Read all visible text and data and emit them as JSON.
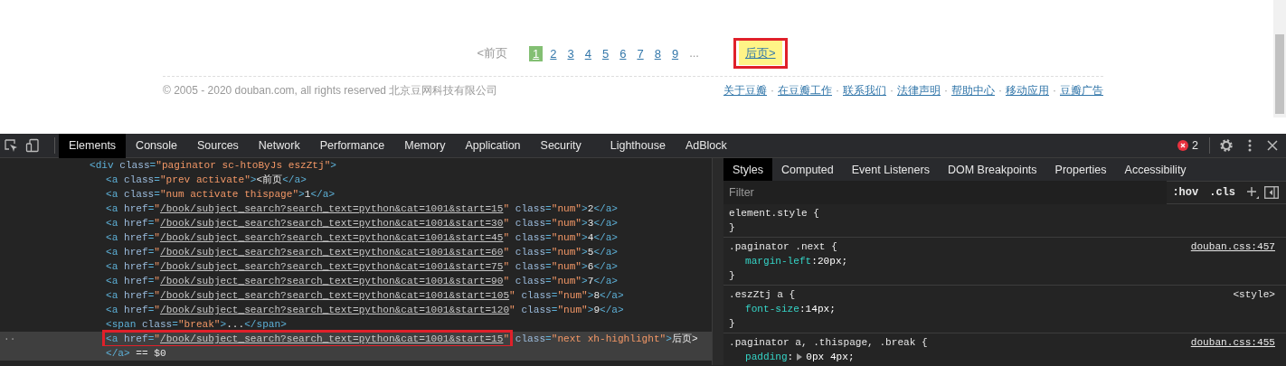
{
  "page": {
    "pagination": {
      "prev": "<前页",
      "pages": [
        {
          "label": "1",
          "selected": true
        },
        {
          "label": "2",
          "selected": false
        },
        {
          "label": "3",
          "selected": false
        },
        {
          "label": "4",
          "selected": false
        },
        {
          "label": "5",
          "selected": false
        },
        {
          "label": "6",
          "selected": false
        },
        {
          "label": "7",
          "selected": false
        },
        {
          "label": "8",
          "selected": false
        },
        {
          "label": "9",
          "selected": false
        }
      ],
      "ellipsis": "...",
      "next": {
        "label": "后页>",
        "highlighted": true,
        "annotated": true
      }
    },
    "footer": {
      "copyright": "© 2005 - 2020 douban.com, all rights reserved 北京豆网科技有限公司",
      "separator": "·",
      "links": [
        "关于豆瓣",
        "在豆瓣工作",
        "联系我们",
        "法律声明",
        "帮助中心",
        "移动应用",
        "豆瓣广告"
      ]
    }
  },
  "devtools": {
    "tabs": [
      {
        "label": "Elements",
        "selected": true
      },
      {
        "label": "Console",
        "selected": false
      },
      {
        "label": "Sources",
        "selected": false
      },
      {
        "label": "Network",
        "selected": false
      },
      {
        "label": "Performance",
        "selected": false
      },
      {
        "label": "Memory",
        "selected": false
      },
      {
        "label": "Application",
        "selected": false
      },
      {
        "label": "Security",
        "selected": false
      },
      {
        "label": "Lighthouse",
        "selected": false
      },
      {
        "label": "AdBlock",
        "selected": false
      }
    ],
    "error_count": "2",
    "elements": {
      "lines": [
        {
          "selected": false,
          "annotated": false,
          "tokens": [
            {
              "kind": "tag",
              "s": "<div"
            },
            {
              "kind": "attr",
              "s": " class"
            },
            {
              "kind": "tag",
              "s": "="
            },
            {
              "kind": "val",
              "s": "\"paginator sc-htoByJs eszZtj\""
            },
            {
              "kind": "tag",
              "s": ">"
            }
          ],
          "children": [
            {
              "selected": false,
              "annotated": false,
              "tokens": [
                {
                  "kind": "tag",
                  "s": "<a"
                },
                {
                  "kind": "attr",
                  "s": " class"
                },
                {
                  "kind": "tag",
                  "s": "="
                },
                {
                  "kind": "val",
                  "s": "\"prev activate\""
                },
                {
                  "kind": "tag",
                  "s": ">"
                },
                {
                  "kind": "text",
                  "s": "<前页"
                },
                {
                  "kind": "tag",
                  "s": "</a>"
                }
              ]
            },
            {
              "selected": false,
              "annotated": false,
              "tokens": [
                {
                  "kind": "tag",
                  "s": "<a"
                },
                {
                  "kind": "attr",
                  "s": " class"
                },
                {
                  "kind": "tag",
                  "s": "="
                },
                {
                  "kind": "val",
                  "s": "\"num activate thispage\""
                },
                {
                  "kind": "tag",
                  "s": ">"
                },
                {
                  "kind": "text",
                  "s": "1"
                },
                {
                  "kind": "tag",
                  "s": "</a>"
                }
              ]
            },
            {
              "selected": false,
              "annotated": false,
              "tokens": [
                {
                  "kind": "tag",
                  "s": "<a"
                },
                {
                  "kind": "attr",
                  "s": " href"
                },
                {
                  "kind": "tag",
                  "s": "="
                },
                {
                  "kind": "val",
                  "s": "\""
                },
                {
                  "kind": "link",
                  "s": "/book/subject_search?search_text=python&cat=1001&start=15"
                },
                {
                  "kind": "val",
                  "s": "\""
                },
                {
                  "kind": "attr",
                  "s": " class"
                },
                {
                  "kind": "tag",
                  "s": "="
                },
                {
                  "kind": "val",
                  "s": "\"num\""
                },
                {
                  "kind": "tag",
                  "s": ">"
                },
                {
                  "kind": "text",
                  "s": "2"
                },
                {
                  "kind": "tag",
                  "s": "</a>"
                }
              ]
            },
            {
              "selected": false,
              "annotated": false,
              "tokens": [
                {
                  "kind": "tag",
                  "s": "<a"
                },
                {
                  "kind": "attr",
                  "s": " href"
                },
                {
                  "kind": "tag",
                  "s": "="
                },
                {
                  "kind": "val",
                  "s": "\""
                },
                {
                  "kind": "link",
                  "s": "/book/subject_search?search_text=python&cat=1001&start=30"
                },
                {
                  "kind": "val",
                  "s": "\""
                },
                {
                  "kind": "attr",
                  "s": " class"
                },
                {
                  "kind": "tag",
                  "s": "="
                },
                {
                  "kind": "val",
                  "s": "\"num\""
                },
                {
                  "kind": "tag",
                  "s": ">"
                },
                {
                  "kind": "text",
                  "s": "3"
                },
                {
                  "kind": "tag",
                  "s": "</a>"
                }
              ]
            },
            {
              "selected": false,
              "annotated": false,
              "tokens": [
                {
                  "kind": "tag",
                  "s": "<a"
                },
                {
                  "kind": "attr",
                  "s": " href"
                },
                {
                  "kind": "tag",
                  "s": "="
                },
                {
                  "kind": "val",
                  "s": "\""
                },
                {
                  "kind": "link",
                  "s": "/book/subject_search?search_text=python&cat=1001&start=45"
                },
                {
                  "kind": "val",
                  "s": "\""
                },
                {
                  "kind": "attr",
                  "s": " class"
                },
                {
                  "kind": "tag",
                  "s": "="
                },
                {
                  "kind": "val",
                  "s": "\"num\""
                },
                {
                  "kind": "tag",
                  "s": ">"
                },
                {
                  "kind": "text",
                  "s": "4"
                },
                {
                  "kind": "tag",
                  "s": "</a>"
                }
              ]
            },
            {
              "selected": false,
              "annotated": false,
              "tokens": [
                {
                  "kind": "tag",
                  "s": "<a"
                },
                {
                  "kind": "attr",
                  "s": " href"
                },
                {
                  "kind": "tag",
                  "s": "="
                },
                {
                  "kind": "val",
                  "s": "\""
                },
                {
                  "kind": "link",
                  "s": "/book/subject_search?search_text=python&cat=1001&start=60"
                },
                {
                  "kind": "val",
                  "s": "\""
                },
                {
                  "kind": "attr",
                  "s": " class"
                },
                {
                  "kind": "tag",
                  "s": "="
                },
                {
                  "kind": "val",
                  "s": "\"num\""
                },
                {
                  "kind": "tag",
                  "s": ">"
                },
                {
                  "kind": "text",
                  "s": "5"
                },
                {
                  "kind": "tag",
                  "s": "</a>"
                }
              ]
            },
            {
              "selected": false,
              "annotated": false,
              "tokens": [
                {
                  "kind": "tag",
                  "s": "<a"
                },
                {
                  "kind": "attr",
                  "s": " href"
                },
                {
                  "kind": "tag",
                  "s": "="
                },
                {
                  "kind": "val",
                  "s": "\""
                },
                {
                  "kind": "link",
                  "s": "/book/subject_search?search_text=python&cat=1001&start=75"
                },
                {
                  "kind": "val",
                  "s": "\""
                },
                {
                  "kind": "attr",
                  "s": " class"
                },
                {
                  "kind": "tag",
                  "s": "="
                },
                {
                  "kind": "val",
                  "s": "\"num\""
                },
                {
                  "kind": "tag",
                  "s": ">"
                },
                {
                  "kind": "text",
                  "s": "6"
                },
                {
                  "kind": "tag",
                  "s": "</a>"
                }
              ]
            },
            {
              "selected": false,
              "annotated": false,
              "tokens": [
                {
                  "kind": "tag",
                  "s": "<a"
                },
                {
                  "kind": "attr",
                  "s": " href"
                },
                {
                  "kind": "tag",
                  "s": "="
                },
                {
                  "kind": "val",
                  "s": "\""
                },
                {
                  "kind": "link",
                  "s": "/book/subject_search?search_text=python&cat=1001&start=90"
                },
                {
                  "kind": "val",
                  "s": "\""
                },
                {
                  "kind": "attr",
                  "s": " class"
                },
                {
                  "kind": "tag",
                  "s": "="
                },
                {
                  "kind": "val",
                  "s": "\"num\""
                },
                {
                  "kind": "tag",
                  "s": ">"
                },
                {
                  "kind": "text",
                  "s": "7"
                },
                {
                  "kind": "tag",
                  "s": "</a>"
                }
              ]
            },
            {
              "selected": false,
              "annotated": false,
              "tokens": [
                {
                  "kind": "tag",
                  "s": "<a"
                },
                {
                  "kind": "attr",
                  "s": " href"
                },
                {
                  "kind": "tag",
                  "s": "="
                },
                {
                  "kind": "val",
                  "s": "\""
                },
                {
                  "kind": "link",
                  "s": "/book/subject_search?search_text=python&cat=1001&start=105"
                },
                {
                  "kind": "val",
                  "s": "\""
                },
                {
                  "kind": "attr",
                  "s": " class"
                },
                {
                  "kind": "tag",
                  "s": "="
                },
                {
                  "kind": "val",
                  "s": "\"num\""
                },
                {
                  "kind": "tag",
                  "s": ">"
                },
                {
                  "kind": "text",
                  "s": "8"
                },
                {
                  "kind": "tag",
                  "s": "</a>"
                }
              ]
            },
            {
              "selected": false,
              "annotated": false,
              "tokens": [
                {
                  "kind": "tag",
                  "s": "<a"
                },
                {
                  "kind": "attr",
                  "s": " href"
                },
                {
                  "kind": "tag",
                  "s": "="
                },
                {
                  "kind": "val",
                  "s": "\""
                },
                {
                  "kind": "link",
                  "s": "/book/subject_search?search_text=python&cat=1001&start=120"
                },
                {
                  "kind": "val",
                  "s": "\""
                },
                {
                  "kind": "attr",
                  "s": " class"
                },
                {
                  "kind": "tag",
                  "s": "="
                },
                {
                  "kind": "val",
                  "s": "\"num\""
                },
                {
                  "kind": "tag",
                  "s": ">"
                },
                {
                  "kind": "text",
                  "s": "9"
                },
                {
                  "kind": "tag",
                  "s": "</a>"
                }
              ]
            },
            {
              "selected": false,
              "annotated": false,
              "tokens": [
                {
                  "kind": "tag",
                  "s": "<span"
                },
                {
                  "kind": "attr",
                  "s": " class"
                },
                {
                  "kind": "tag",
                  "s": "="
                },
                {
                  "kind": "val",
                  "s": "\"break\""
                },
                {
                  "kind": "tag",
                  "s": ">"
                },
                {
                  "kind": "text",
                  "s": "..."
                },
                {
                  "kind": "tag",
                  "s": "</span>"
                }
              ]
            },
            {
              "selected": true,
              "annotated": true,
              "gutter": "··",
              "tokens": [
                {
                  "kind": "tag",
                  "s": "<a"
                },
                {
                  "kind": "attr",
                  "s": " href"
                },
                {
                  "kind": "tag",
                  "s": "="
                },
                {
                  "kind": "val",
                  "s": "\""
                },
                {
                  "kind": "link",
                  "s": "/book/subject_search?search_text=python&cat=1001&start=15"
                },
                {
                  "kind": "val",
                  "s": "\""
                },
                {
                  "kind": "attr",
                  "s": " class"
                },
                {
                  "kind": "tag",
                  "s": "="
                },
                {
                  "kind": "val",
                  "s": "\"next xh-highlight\""
                },
                {
                  "kind": "tag",
                  "s": ">"
                },
                {
                  "kind": "text",
                  "s": "后页>"
                }
              ]
            },
            {
              "selected": true,
              "annotated": false,
              "tokens": [
                {
                  "kind": "tag",
                  "s": "</a>"
                },
                {
                  "kind": "text",
                  "s": " == $0"
                }
              ]
            }
          ]
        }
      ]
    },
    "styles_tabs": [
      {
        "label": "Styles",
        "selected": true
      },
      {
        "label": "Computed",
        "selected": false
      },
      {
        "label": "Event Listeners",
        "selected": false
      },
      {
        "label": "DOM Breakpoints",
        "selected": false
      },
      {
        "label": "Properties",
        "selected": false
      },
      {
        "label": "Accessibility",
        "selected": false
      }
    ],
    "filter": {
      "placeholder": "Filter"
    },
    "hov": ":hov",
    "cls": ".cls",
    "rules": [
      {
        "selector": "element.style {",
        "close": "}"
      },
      {
        "selector": ".paginator .next {",
        "source": "douban.css:457",
        "props": [
          {
            "name": "margin-left",
            "colon": ":",
            "value": "20px;",
            "expandable": false
          }
        ],
        "close": "}"
      },
      {
        "selector": ".eszZtj a {",
        "source": "<style>",
        "props": [
          {
            "name": "font-size",
            "colon": ":",
            "value": "14px;",
            "expandable": false
          }
        ],
        "close": "}"
      },
      {
        "selector": ".paginator a, .thispage, .break {",
        "source": "douban.css:455",
        "props": [
          {
            "name": "padding",
            "colon": ":",
            "value": "0px 4px;",
            "expandable": true
          }
        ]
      }
    ]
  }
}
